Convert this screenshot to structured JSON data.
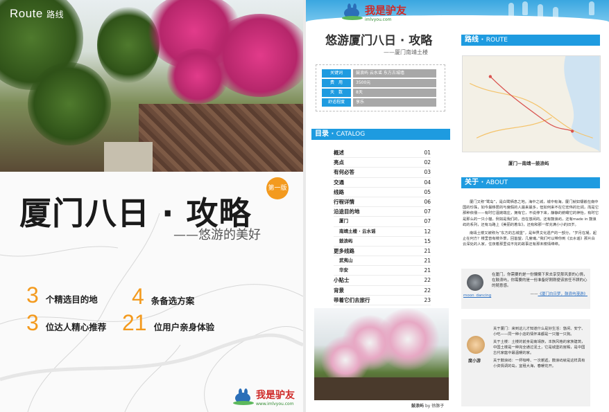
{
  "cover": {
    "route_label": "Route",
    "route_cn": "路线",
    "title": "厦门八日 · 攻略",
    "edition_badge": "第一版",
    "subtitle": "——悠游的美好",
    "stats": [
      {
        "num": "3",
        "text": "个精选目的地"
      },
      {
        "num": "4",
        "text": "条备选方案"
      },
      {
        "num": "3",
        "text": "位达人精心推荐"
      },
      {
        "num": "21",
        "text": "位用户亲身体验"
      }
    ],
    "logo": {
      "text": "我是驴友",
      "url": "www.imlvyou.com"
    }
  },
  "guide": {
    "header_logo": {
      "text": "我是驴友",
      "url": "imlvyou.com"
    },
    "title": "悠游厦门八日 · 攻略",
    "subtitle": "——厦门南靖土楼",
    "info": [
      {
        "label": "关键词",
        "value": "鼓浪屿 云水谣 东方古城墙"
      },
      {
        "label": "费　用",
        "value": "3500元"
      },
      {
        "label": "天　数",
        "value": "8天"
      },
      {
        "label": "舒适程度",
        "value": "享乐"
      }
    ],
    "catalog_heading": {
      "cn": "目录",
      "en": "CATALOG"
    },
    "toc": [
      {
        "title": "概述",
        "page": "01",
        "sub": false
      },
      {
        "title": "亮点",
        "page": "02",
        "sub": false
      },
      {
        "title": "有何必答",
        "page": "03",
        "sub": false
      },
      {
        "title": "交通",
        "page": "04",
        "sub": false
      },
      {
        "title": "线路",
        "page": "05",
        "sub": false
      },
      {
        "title": "行程详情",
        "page": "06",
        "sub": false
      },
      {
        "title": "沿途目的地",
        "page": "07",
        "sub": false
      },
      {
        "title": "厦门",
        "page": "07",
        "sub": true
      },
      {
        "title": "南靖土楼 · 云水谣",
        "page": "12",
        "sub": true
      },
      {
        "title": "鼓浪屿",
        "page": "15",
        "sub": true
      },
      {
        "title": "更多线路",
        "page": "21",
        "sub": false
      },
      {
        "title": "武夷山",
        "page": "21",
        "sub": true
      },
      {
        "title": "华安",
        "page": "21",
        "sub": true
      },
      {
        "title": "小贴士",
        "page": "22",
        "sub": false
      },
      {
        "title": "背景",
        "page": "22",
        "sub": false
      },
      {
        "title": "带着它们去旅行",
        "page": "23",
        "sub": false
      }
    ],
    "photo_caption": {
      "place": "鼓浪屿",
      "by": "by 徐豚子"
    },
    "route_heading": {
      "cn": "路线",
      "en": "ROUTE"
    },
    "map_caption": "厦门—南靖—鼓浪屿",
    "about_heading": {
      "cn": "关于",
      "en": "ABOUT"
    },
    "about_paragraphs": [
      "厦门又称“鹭岛”，是白鹭栖息之地。海中之城，城中有海，厦门就如镶嵌在南中国的珍珠，如今最移居的与度假的人最来最多，但如何来不在它宏伟的壮阔，而是它那种依偎——有时它温婉端庄，拥有它，不说停下来，静静的俯瞰它的神怡，有时它是那么的一只小猫，例如是我们的，自在悠闲的。还有鼓浪屿，还有made in 鼓浪屿的系列，还有马路上《美丽的着车》，还有和那一样充满小小的旧岁。",
      "南靖土楼又被称为“东方的古城堡”，是世界文化遗产的一部分。“岁月在凝，起止在何方？楼里曾有楼外景，回首望，几度魂。”我们可以带你到《云水谣》那片白云深处的人家，住夜着那里说不完的故事还有那未楼情绵绵。"
    ],
    "quote": {
      "text": "在厦门，你需要的是一份慵懒下来去享受那风景的心情，在鼓浪屿，你需要的是一份准备好刚刚便该放任不顾的心的随意感。",
      "source_prefix": "——",
      "source_link": "《厦门白日梦，鼓浪屿漫游》",
      "author": "moon_dancing"
    },
    "tips": {
      "author": "度小游",
      "paragraphs": [
        "关于厦门：来到这儿才知道什么是好生活：悠闲、安宁、小吃——同一种小店的情怀来都是一只猫一只狗。",
        "关于土楼：土楼的前身是南靖族，本族风格的家族建筑，中国土楼是一种完全通过泥土，它是城堡的宫殿，是中国古代家庭中最温暖的家。",
        "关于鼓浪屿：一杯咖啡、一次邂逅，鼓浪屿就是这样具有小资情调的岛，宜租大海，春暖花开。"
      ]
    },
    "colors": {
      "accent": "#1e9be0",
      "orange": "#f39a1e",
      "logo_red": "#cf2a28"
    }
  }
}
